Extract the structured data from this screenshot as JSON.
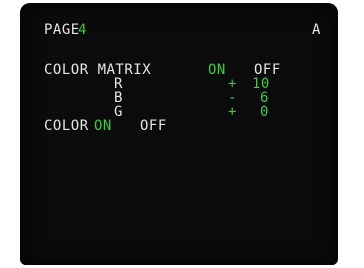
{
  "header": {
    "page_label": "PAGE",
    "page_number": "4",
    "mode": "A"
  },
  "color_matrix": {
    "label": "COLOR MATRIX",
    "on_label": "ON",
    "off_label": "OFF",
    "rows": [
      {
        "channel": "R",
        "sign": "+",
        "value": "10"
      },
      {
        "channel": "B",
        "sign": "-",
        "value": "6"
      },
      {
        "channel": "G",
        "sign": "+",
        "value": "0"
      }
    ]
  },
  "color": {
    "label": "COLOR",
    "on_label": "ON",
    "off_label": "OFF"
  },
  "colors": {
    "selected": "#33d13a",
    "text": "#e6e6e6",
    "background": "#0b0b0b"
  }
}
